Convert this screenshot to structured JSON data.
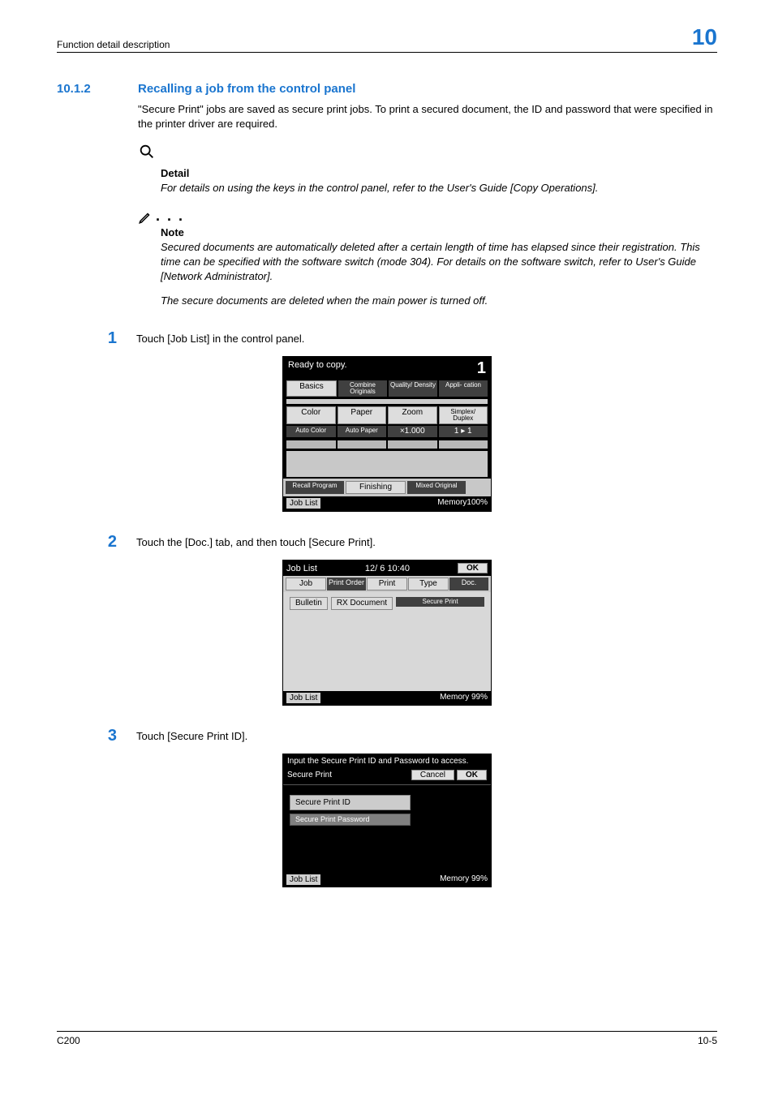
{
  "header": {
    "left": "Function detail description",
    "right": "10"
  },
  "section": {
    "number": "10.1.2",
    "title": "Recalling a job from the control panel",
    "intro": "\"Secure Print\" jobs are saved as secure print jobs. To print a secured document, the ID and password that were specified in the printer driver are required."
  },
  "detail": {
    "label": "Detail",
    "text": "For details on using the keys in the control panel, refer to the User's Guide [Copy Operations]."
  },
  "note": {
    "dots": ". . .",
    "label": "Note",
    "text1": "Secured documents are automatically deleted after a certain length of time has elapsed since their registration. This time can be specified with the software switch (mode 304). For details on the software switch, refer to User's Guide [Network Administrator].",
    "text2": "The secure documents are deleted when the main power is turned off."
  },
  "steps": [
    {
      "num": "1",
      "text": "Touch [Job List] in the control panel."
    },
    {
      "num": "2",
      "text": "Touch the [Doc.] tab, and then touch [Secure Print]."
    },
    {
      "num": "3",
      "text": "Touch [Secure Print ID]."
    }
  ],
  "panel1": {
    "title": "Ready to copy.",
    "counter": "1",
    "tabs": [
      "Basics",
      "Combine Originals",
      "Quality/ Density",
      "Appli- cation"
    ],
    "row2": [
      "Color",
      "Paper",
      "Zoom",
      "Simplex/ Duplex"
    ],
    "row3": [
      "Auto Color",
      "Auto Paper",
      "×1.000",
      "1 ▸ 1"
    ],
    "bottom_tabs": [
      "Recall Program",
      "Finishing",
      "Mixed Original"
    ],
    "joblist": "Job List",
    "memory": "Memory100%"
  },
  "panel2": {
    "title": "Job List",
    "datetime": "12/ 6 10:40",
    "ok": "OK",
    "tabs": [
      "Job",
      "Print Order",
      "Print",
      "Type",
      "Doc."
    ],
    "body_btns": [
      "Bulletin",
      "RX Document",
      "Secure Print"
    ],
    "joblist": "Job List",
    "memory": "Memory 99%"
  },
  "panel3": {
    "title": "Input the Secure Print ID and Password to access.",
    "subtitle": "Secure Print",
    "cancel": "Cancel",
    "ok": "OK",
    "field1": "Secure Print ID",
    "field2": "Secure Print Password",
    "joblist": "Job List",
    "memory": "Memory 99%"
  },
  "footer": {
    "left": "C200",
    "right": "10-5"
  }
}
